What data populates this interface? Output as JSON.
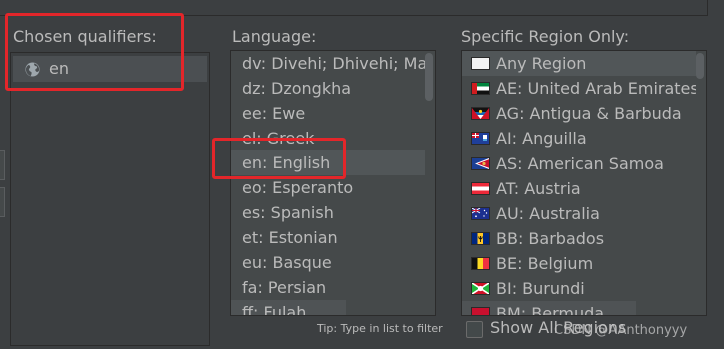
{
  "qualifiers": {
    "label": "Chosen qualifiers:",
    "items": [
      {
        "text": "en",
        "icon": "globe-icon"
      }
    ]
  },
  "language": {
    "label": "Language:",
    "items": [
      {
        "text": "dv: Divehi; Dhivehi; Maldivian"
      },
      {
        "text": "dz: Dzongkha"
      },
      {
        "text": "ee: Ewe"
      },
      {
        "text": "el: Greek"
      },
      {
        "text": "en: English",
        "selected": true
      },
      {
        "text": "eo: Esperanto"
      },
      {
        "text": "es: Spanish"
      },
      {
        "text": "et: Estonian"
      },
      {
        "text": "eu: Basque"
      },
      {
        "text": "fa: Persian"
      },
      {
        "text": "ff: Fulah"
      }
    ]
  },
  "region": {
    "label": "Specific Region Only:",
    "items": [
      {
        "text": "Any Region",
        "flag": "blank-flag",
        "selected": true
      },
      {
        "text": "AE: United Arab Emirates",
        "flag": "ae-flag"
      },
      {
        "text": "AG: Antigua & Barbuda",
        "flag": "ag-flag"
      },
      {
        "text": "AI: Anguilla",
        "flag": "ai-flag"
      },
      {
        "text": "AS: American Samoa",
        "flag": "as-flag"
      },
      {
        "text": "AT: Austria",
        "flag": "at-flag"
      },
      {
        "text": "AU: Australia",
        "flag": "au-flag"
      },
      {
        "text": "BB: Barbados",
        "flag": "bb-flag"
      },
      {
        "text": "BE: Belgium",
        "flag": "be-flag"
      },
      {
        "text": "BI: Burundi",
        "flag": "bi-flag"
      },
      {
        "text": "BM: Bermuda",
        "flag": "bm-flag"
      }
    ]
  },
  "tip": "Tip: Type in list to filter",
  "show_all": {
    "label": "Show All Regions",
    "checked": false
  },
  "watermark": "CSDN @AAnthonyyy",
  "colors": {
    "background": "#3c3f41",
    "list_background": "#45494a",
    "selection": "#515658",
    "highlight_box": "#e3262a"
  }
}
